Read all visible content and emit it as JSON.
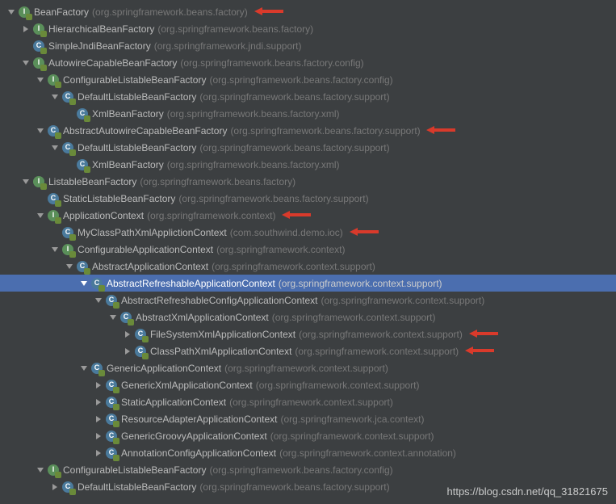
{
  "watermark": "https://blog.csdn.net/qq_31821675",
  "nodes": [
    {
      "depth": 0,
      "arrow": "down",
      "icon": "interface",
      "letter": "I",
      "name": "BeanFactory",
      "pkg": "(org.springframework.beans.factory)",
      "selected": false,
      "redArrow": true
    },
    {
      "depth": 1,
      "arrow": "right",
      "icon": "interface",
      "letter": "I",
      "name": "HierarchicalBeanFactory",
      "pkg": "(org.springframework.beans.factory)",
      "selected": false,
      "redArrow": false
    },
    {
      "depth": 1,
      "arrow": "none",
      "icon": "class",
      "letter": "C",
      "name": "SimpleJndiBeanFactory",
      "pkg": "(org.springframework.jndi.support)",
      "selected": false,
      "redArrow": false
    },
    {
      "depth": 1,
      "arrow": "down",
      "icon": "interface",
      "letter": "I",
      "name": "AutowireCapableBeanFactory",
      "pkg": "(org.springframework.beans.factory.config)",
      "selected": false,
      "redArrow": false
    },
    {
      "depth": 2,
      "arrow": "down",
      "icon": "interface",
      "letter": "I",
      "name": "ConfigurableListableBeanFactory",
      "pkg": "(org.springframework.beans.factory.config)",
      "selected": false,
      "redArrow": false
    },
    {
      "depth": 3,
      "arrow": "down",
      "icon": "class",
      "letter": "C",
      "name": "DefaultListableBeanFactory",
      "pkg": "(org.springframework.beans.factory.support)",
      "selected": false,
      "redArrow": false
    },
    {
      "depth": 4,
      "arrow": "none",
      "icon": "class",
      "letter": "C",
      "name": "XmlBeanFactory",
      "pkg": "(org.springframework.beans.factory.xml)",
      "selected": false,
      "redArrow": false
    },
    {
      "depth": 2,
      "arrow": "down",
      "icon": "abstract",
      "letter": "C",
      "name": "AbstractAutowireCapableBeanFactory",
      "pkg": "(org.springframework.beans.factory.support)",
      "selected": false,
      "redArrow": true
    },
    {
      "depth": 3,
      "arrow": "down",
      "icon": "class",
      "letter": "C",
      "name": "DefaultListableBeanFactory",
      "pkg": "(org.springframework.beans.factory.support)",
      "selected": false,
      "redArrow": false
    },
    {
      "depth": 4,
      "arrow": "none",
      "icon": "class",
      "letter": "C",
      "name": "XmlBeanFactory",
      "pkg": "(org.springframework.beans.factory.xml)",
      "selected": false,
      "redArrow": false
    },
    {
      "depth": 1,
      "arrow": "down",
      "icon": "interface",
      "letter": "I",
      "name": "ListableBeanFactory",
      "pkg": "(org.springframework.beans.factory)",
      "selected": false,
      "redArrow": false
    },
    {
      "depth": 2,
      "arrow": "none",
      "icon": "class",
      "letter": "C",
      "name": "StaticListableBeanFactory",
      "pkg": "(org.springframework.beans.factory.support)",
      "selected": false,
      "redArrow": false
    },
    {
      "depth": 2,
      "arrow": "down",
      "icon": "interface",
      "letter": "I",
      "name": "ApplicationContext",
      "pkg": "(org.springframework.context)",
      "selected": false,
      "redArrow": true
    },
    {
      "depth": 3,
      "arrow": "none",
      "icon": "class",
      "letter": "C",
      "name": "MyClassPathXmlApplictionContext",
      "pkg": "(com.southwind.demo.ioc)",
      "selected": false,
      "redArrow": true
    },
    {
      "depth": 3,
      "arrow": "down",
      "icon": "interface",
      "letter": "I",
      "name": "ConfigurableApplicationContext",
      "pkg": "(org.springframework.context)",
      "selected": false,
      "redArrow": false
    },
    {
      "depth": 4,
      "arrow": "down",
      "icon": "abstract",
      "letter": "C",
      "name": "AbstractApplicationContext",
      "pkg": "(org.springframework.context.support)",
      "selected": false,
      "redArrow": false
    },
    {
      "depth": 5,
      "arrow": "down",
      "icon": "abstract",
      "letter": "C",
      "name": "AbstractRefreshableApplicationContext",
      "pkg": "(org.springframework.context.support)",
      "selected": true,
      "redArrow": false
    },
    {
      "depth": 6,
      "arrow": "down",
      "icon": "abstract",
      "letter": "C",
      "name": "AbstractRefreshableConfigApplicationContext",
      "pkg": "(org.springframework.context.support)",
      "selected": false,
      "redArrow": false
    },
    {
      "depth": 7,
      "arrow": "down",
      "icon": "abstract",
      "letter": "C",
      "name": "AbstractXmlApplicationContext",
      "pkg": "(org.springframework.context.support)",
      "selected": false,
      "redArrow": false
    },
    {
      "depth": 8,
      "arrow": "right",
      "icon": "class",
      "letter": "C",
      "name": "FileSystemXmlApplicationContext",
      "pkg": "(org.springframework.context.support)",
      "selected": false,
      "redArrow": true
    },
    {
      "depth": 8,
      "arrow": "right",
      "icon": "class",
      "letter": "C",
      "name": "ClassPathXmlApplicationContext",
      "pkg": "(org.springframework.context.support)",
      "selected": false,
      "redArrow": true
    },
    {
      "depth": 5,
      "arrow": "down",
      "icon": "class",
      "letter": "C",
      "name": "GenericApplicationContext",
      "pkg": "(org.springframework.context.support)",
      "selected": false,
      "redArrow": false
    },
    {
      "depth": 6,
      "arrow": "right",
      "icon": "class",
      "letter": "C",
      "name": "GenericXmlApplicationContext",
      "pkg": "(org.springframework.context.support)",
      "selected": false,
      "redArrow": false
    },
    {
      "depth": 6,
      "arrow": "right",
      "icon": "class",
      "letter": "C",
      "name": "StaticApplicationContext",
      "pkg": "(org.springframework.context.support)",
      "selected": false,
      "redArrow": false
    },
    {
      "depth": 6,
      "arrow": "right",
      "icon": "class",
      "letter": "C",
      "name": "ResourceAdapterApplicationContext",
      "pkg": "(org.springframework.jca.context)",
      "selected": false,
      "redArrow": false
    },
    {
      "depth": 6,
      "arrow": "right",
      "icon": "class",
      "letter": "C",
      "name": "GenericGroovyApplicationContext",
      "pkg": "(org.springframework.context.support)",
      "selected": false,
      "redArrow": false
    },
    {
      "depth": 6,
      "arrow": "right",
      "icon": "class",
      "letter": "C",
      "name": "AnnotationConfigApplicationContext",
      "pkg": "(org.springframework.context.annotation)",
      "selected": false,
      "redArrow": false
    },
    {
      "depth": 2,
      "arrow": "down",
      "icon": "interface",
      "letter": "I",
      "name": "ConfigurableListableBeanFactory",
      "pkg": "(org.springframework.beans.factory.config)",
      "selected": false,
      "redArrow": false
    },
    {
      "depth": 3,
      "arrow": "right",
      "icon": "class",
      "letter": "C",
      "name": "DefaultListableBeanFactory",
      "pkg": "(org.springframework.beans.factory.support)",
      "selected": false,
      "redArrow": false
    }
  ]
}
